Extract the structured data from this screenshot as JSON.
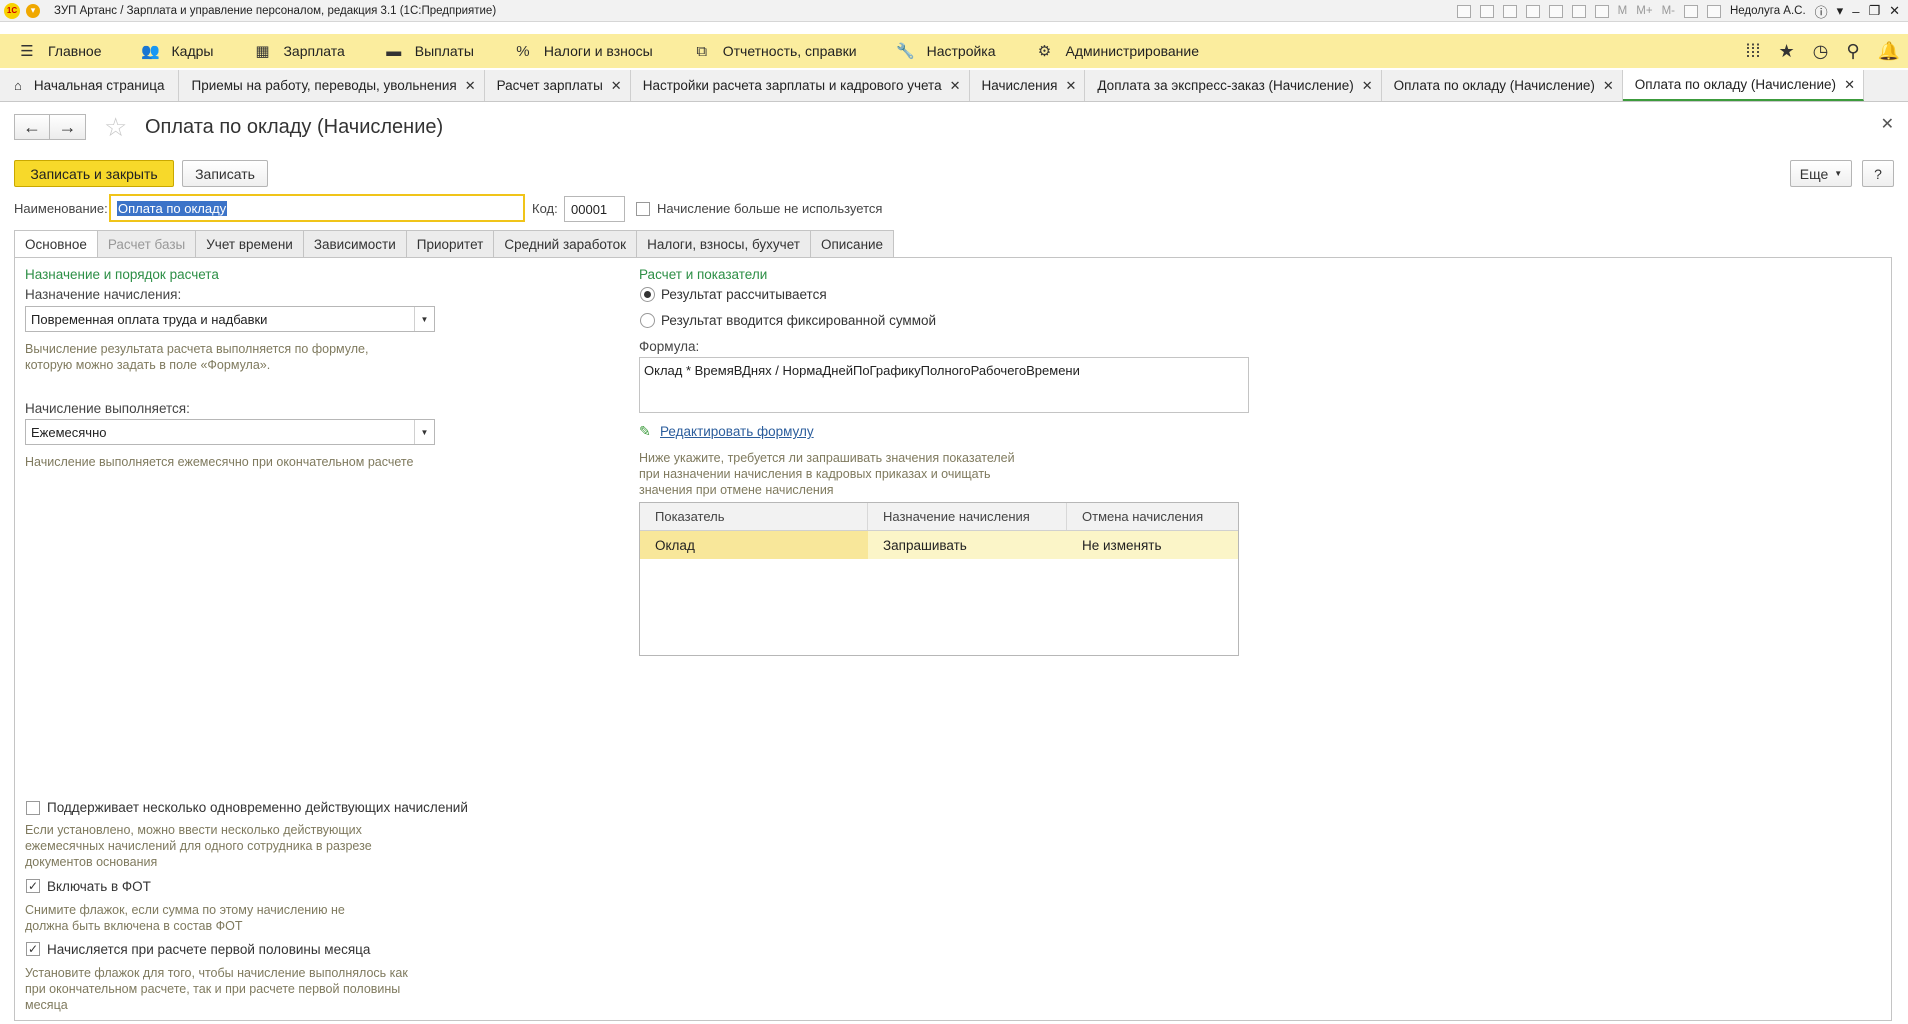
{
  "window": {
    "title": "ЗУП Артанс / Зарплата и управление персоналом, редакция 3.1  (1С:Предприятие)",
    "logo_text": "1С",
    "tools": [
      "M",
      "M+",
      "M-"
    ],
    "user": "Недолуга А.С."
  },
  "menu": {
    "items": [
      {
        "label": "Главное",
        "icon": "hamburger-icon"
      },
      {
        "label": "Кадры",
        "icon": "people-icon"
      },
      {
        "label": "Зарплата",
        "icon": "calculator-icon"
      },
      {
        "label": "Выплаты",
        "icon": "wallet-icon"
      },
      {
        "label": "Налоги и взносы",
        "icon": "percent-icon"
      },
      {
        "label": "Отчетность, справки",
        "icon": "reports-icon"
      },
      {
        "label": "Настройка",
        "icon": "wrench-icon"
      },
      {
        "label": "Администрирование",
        "icon": "gear-icon"
      }
    ]
  },
  "tabs": [
    {
      "label": "Начальная страница"
    },
    {
      "label": "Приемы на работу, переводы, увольнения"
    },
    {
      "label": "Расчет зарплаты"
    },
    {
      "label": "Настройки расчета зарплаты и кадрового учета"
    },
    {
      "label": "Начисления"
    },
    {
      "label": "Доплата за экспресс-заказ (Начисление)"
    },
    {
      "label": "Оплата по окладу (Начисление)"
    },
    {
      "label": "Оплата по окладу (Начисление)"
    }
  ],
  "form": {
    "title": "Оплата по окладу (Начисление)",
    "save_close_label": "Записать и закрыть",
    "save_label": "Записать",
    "more_label": "Еще",
    "help_label": "?",
    "name_label": "Наименование:",
    "name_value": "Оплата по окладу",
    "code_label": "Код:",
    "code_value": "00001",
    "unused_label": "Начисление больше не используется",
    "unused_checked": false
  },
  "form_tabs": [
    {
      "label": "Основное",
      "active": true
    },
    {
      "label": "Расчет базы",
      "disabled": true
    },
    {
      "label": "Учет времени"
    },
    {
      "label": "Зависимости"
    },
    {
      "label": "Приоритет"
    },
    {
      "label": "Средний заработок"
    },
    {
      "label": "Налоги, взносы, бухучет"
    },
    {
      "label": "Описание"
    }
  ],
  "left": {
    "group_title": "Назначение и порядок расчета",
    "purpose_label": "Назначение начисления:",
    "purpose_value": "Повременная оплата труда и надбавки",
    "purpose_hint_1": "Вычисление результата расчета выполняется по формуле,",
    "purpose_hint_2": "которую можно задать в поле «Формула».",
    "period_label": "Начисление выполняется:",
    "period_value": "Ежемесячно",
    "period_hint": "Начисление выполняется ежемесячно при окончательном расчете",
    "multi_label": "Поддерживает несколько одновременно действующих начислений",
    "multi_checked": false,
    "multi_hint_1": "Если установлено, можно ввести несколько действующих",
    "multi_hint_2": "ежемесячных начислений для одного сотрудника в разрезе",
    "multi_hint_3": "документов основания",
    "fot_label": "Включать в ФОТ",
    "fot_checked": true,
    "fot_hint_1": "Снимите флажок, если сумма по этому начислению не",
    "fot_hint_2": "должна быть включена в состав ФОТ",
    "half_label": "Начисляется при расчете первой половины месяца",
    "half_checked": true,
    "half_hint_1": "Установите флажок для того, чтобы начисление выполнялось как",
    "half_hint_2": "при окончательном расчете, так и при расчете первой половины",
    "half_hint_3": "месяца"
  },
  "right": {
    "group_title": "Расчет и показатели",
    "radio_calc": "Результат рассчитывается",
    "radio_fixed": "Результат вводится фиксированной суммой",
    "radio_selected": "calc",
    "formula_label": "Формула:",
    "formula_value": "Оклад * ВремяВДнях / НормаДнейПоГрафикуПолногоРабочегоВремени",
    "edit_formula": "Редактировать формулу",
    "hint_1": "Ниже укажите, требуется ли запрашивать значения показателей",
    "hint_2": "при назначении начисления в кадровых приказах и очищать",
    "hint_3": "значения при отмене начисления",
    "table": {
      "headers": [
        "Показатель",
        "Назначение начисления",
        "Отмена начисления"
      ],
      "rows": [
        [
          "Оклад",
          "Запрашивать",
          "Не изменять"
        ]
      ]
    }
  }
}
